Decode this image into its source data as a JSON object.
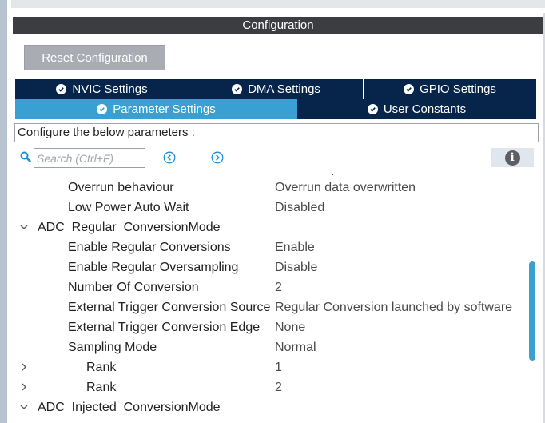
{
  "panel": {
    "title": "Configuration"
  },
  "toolbar": {
    "reset_label": "Reset Configuration"
  },
  "tabs": [
    {
      "label": "NVIC Settings",
      "active": false
    },
    {
      "label": "DMA Settings",
      "active": false
    },
    {
      "label": "GPIO Settings",
      "active": false
    },
    {
      "label": "Parameter Settings",
      "active": true
    },
    {
      "label": "User Constants",
      "active": false
    }
  ],
  "config": {
    "prompt": "Configure the below parameters :"
  },
  "search": {
    "placeholder": "Search (Ctrl+F)",
    "value": ""
  },
  "icons": {
    "search": "search-icon",
    "prev": "chevron-left-circle-icon",
    "next": "chevron-right-circle-icon",
    "info": "info-icon",
    "tab_check": "check-circle-icon",
    "expand": "chevron-down-icon",
    "collapse": "chevron-right-icon"
  },
  "tree": {
    "rows": [
      {
        "name": "Overrun behaviour",
        "value": "Overrun data overwritten"
      },
      {
        "name": "Low Power Auto Wait",
        "value": "Disabled"
      },
      {
        "name": "ADC_Regular_ConversionMode",
        "value": ""
      },
      {
        "name": "Enable Regular Conversions",
        "value": "Enable"
      },
      {
        "name": "Enable Regular Oversampling",
        "value": "Disable"
      },
      {
        "name": "Number Of Conversion",
        "value": "2"
      },
      {
        "name": "External Trigger Conversion Source",
        "value": "Regular Conversion launched by software"
      },
      {
        "name": "External Trigger Conversion Edge",
        "value": "None"
      },
      {
        "name": "Sampling Mode",
        "value": "Normal"
      },
      {
        "name": "Rank",
        "value": "1"
      },
      {
        "name": "Rank",
        "value": "2"
      },
      {
        "name": "ADC_Injected_ConversionMode",
        "value": ""
      }
    ]
  },
  "colors": {
    "header_bg": "#3b3d40",
    "tab_dark": "#07254a",
    "tab_active": "#39a0d4",
    "button_bg": "#a9adb3",
    "scroll_thumb": "#39a0d4"
  }
}
